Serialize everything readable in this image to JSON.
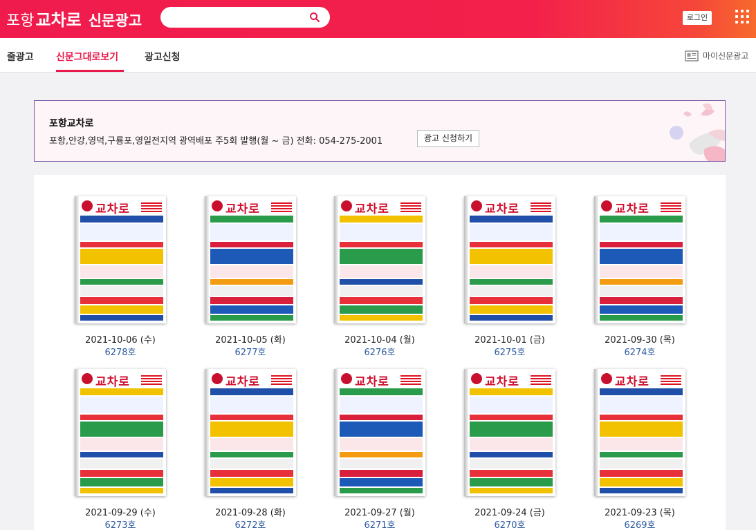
{
  "header": {
    "logo_part1": "포항",
    "logo_part2": "교차로",
    "logo_part3": "신문광고",
    "search_placeholder": "",
    "login_label": "로그인"
  },
  "nav": {
    "tabs": [
      {
        "label": "줄광고"
      },
      {
        "label": "신문그대로보기",
        "active": true
      },
      {
        "label": "광고신청"
      }
    ],
    "my_ad_label": "마이신문광고"
  },
  "info": {
    "paper_name": "포항교차로",
    "description": "포항,안강,영덕,구룡포,영일전지역 광역배포 주5회 발행(월 ~ 금) 전화: 054-275-2001",
    "apply_label": "광고 신청하기"
  },
  "issues": [
    {
      "date": "2021-10-06 (수)",
      "no": "6278호"
    },
    {
      "date": "2021-10-05 (화)",
      "no": "6277호"
    },
    {
      "date": "2021-10-04 (월)",
      "no": "6276호"
    },
    {
      "date": "2021-10-01 (금)",
      "no": "6275호"
    },
    {
      "date": "2021-09-30 (목)",
      "no": "6274호"
    },
    {
      "date": "2021-09-29 (수)",
      "no": "6273호"
    },
    {
      "date": "2021-09-28 (화)",
      "no": "6272호"
    },
    {
      "date": "2021-09-27 (월)",
      "no": "6271호"
    },
    {
      "date": "2021-09-24 (금)",
      "no": "6270호"
    },
    {
      "date": "2021-09-23 (목)",
      "no": "6269호"
    }
  ],
  "thumbnail": {
    "masthead": "교차로"
  },
  "colors": {
    "brand": "#f01b4d",
    "active_tab": "#e8194a",
    "issue_link": "#2c5aa0"
  }
}
